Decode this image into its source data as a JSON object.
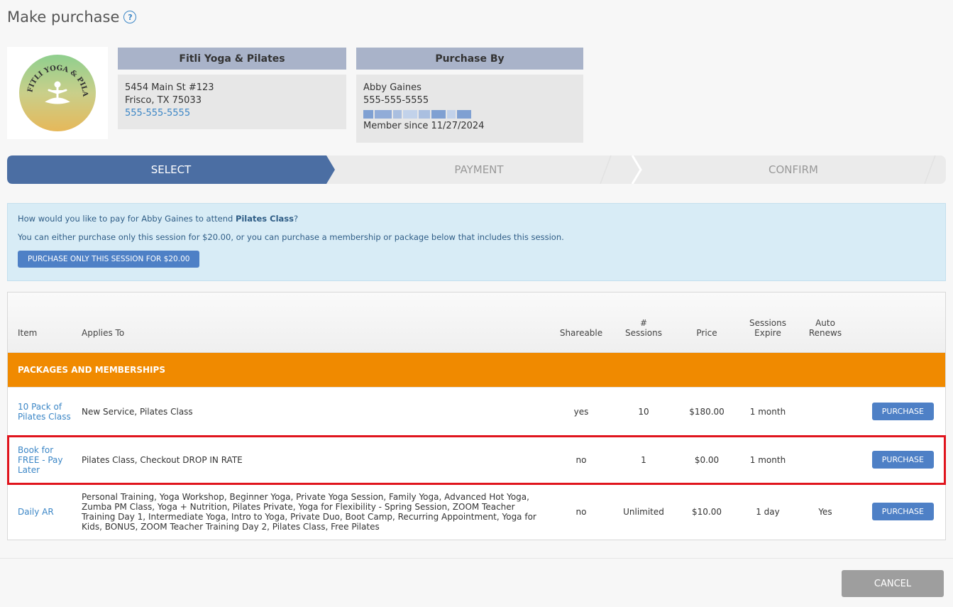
{
  "page": {
    "title": "Make purchase",
    "help_icon": "?"
  },
  "studio": {
    "logo_alt": "FITLI YOGA & PILATES",
    "name": "Fitli Yoga & Pilates",
    "address_line1": "5454 Main St #123",
    "address_line2": "Frisco, TX 75033",
    "phone": "555-555-5555"
  },
  "purchaser": {
    "heading": "Purchase By",
    "name": "Abby Gaines",
    "phone": "555-555-5555",
    "member_since": "Member since 11/27/2024"
  },
  "steps": [
    {
      "label": "SELECT",
      "active": true
    },
    {
      "label": "PAYMENT",
      "active": false
    },
    {
      "label": "CONFIRM",
      "active": false
    }
  ],
  "info": {
    "question_prefix": "How would you like to pay for Abby Gaines to attend ",
    "question_class": "Pilates Class",
    "question_suffix": "?",
    "explanation": "You can either purchase only this session for $20.00, or you can purchase a membership or package below that includes this session.",
    "session_button": "PURCHASE ONLY THIS SESSION FOR $20.00"
  },
  "table": {
    "headers": {
      "item": "Item",
      "applies_to": "Applies To",
      "shareable": "Shareable",
      "sessions_line1": "#",
      "sessions_line2": "Sessions",
      "price": "Price",
      "expire_line1": "Sessions",
      "expire_line2": "Expire",
      "renews_line1": "Auto",
      "renews_line2": "Renews"
    },
    "section_label": "PACKAGES AND MEMBERSHIPS",
    "rows": [
      {
        "item": "10 Pack of Pilates Class",
        "applies_to": "New Service, Pilates Class",
        "shareable": "yes",
        "sessions": "10",
        "price": "$180.00",
        "expire": "1 month",
        "auto_renews": "",
        "button": "PURCHASE"
      },
      {
        "item": "Book for FREE - Pay Later",
        "applies_to": "Pilates Class, Checkout DROP IN RATE",
        "shareable": "no",
        "sessions": "1",
        "price": "$0.00",
        "expire": "1 month",
        "auto_renews": "",
        "button": "PURCHASE"
      },
      {
        "item": "Daily AR",
        "applies_to": "Personal Training, Yoga Workshop, Beginner Yoga, Private Yoga Session, Family Yoga, Advanced Hot Yoga, Zumba PM Class, Yoga + Nutrition, Pilates Private, Yoga for Flexibility - Spring Session, ZOOM Teacher Training Day 1, Intermediate Yoga, Intro to Yoga, Private Duo, Boot Camp, Recurring Appointment, Yoga for Kids, BONUS, ZOOM Teacher Training Day 2, Pilates Class, Free Pilates",
        "shareable": "no",
        "sessions": "Unlimited",
        "price": "$10.00",
        "expire": "1 day",
        "auto_renews": "Yes",
        "button": "PURCHASE"
      }
    ]
  },
  "footer": {
    "cancel": "CANCEL"
  },
  "colors": {
    "active_step": "#4b6ea3",
    "section_header": "#f08a00",
    "button_blue": "#4e80c6",
    "highlight": "#e0141d"
  }
}
